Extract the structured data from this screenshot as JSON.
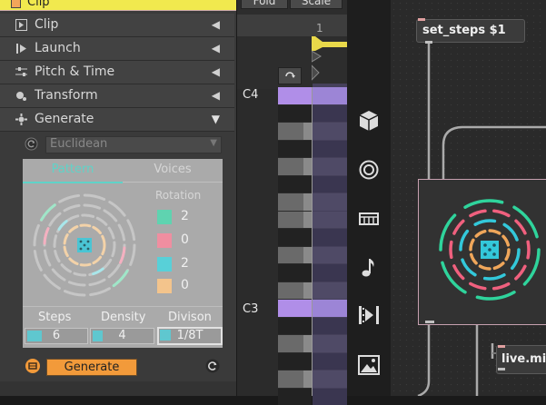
{
  "clip_header": {
    "label": "Clip"
  },
  "sections": [
    {
      "label": "Clip",
      "icon": "clip-icon",
      "arrow": "◀"
    },
    {
      "label": "Launch",
      "icon": "launch-icon",
      "arrow": "◀"
    },
    {
      "label": "Pitch & Time",
      "icon": "sliders-icon",
      "arrow": "◀"
    },
    {
      "label": "Transform",
      "icon": "transform-icon",
      "arrow": "◀"
    },
    {
      "label": "Generate",
      "icon": "generate-icon",
      "arrow": "▼"
    }
  ],
  "generator": {
    "algorithm": "Euclidean",
    "tabs": [
      "Pattern",
      "Voices"
    ],
    "rotation_label": "Rotation",
    "rotations": [
      {
        "value": "2",
        "color": "#5fd3b0"
      },
      {
        "value": "0",
        "color": "#f08ea0"
      },
      {
        "value": "2",
        "color": "#58d0d8"
      },
      {
        "value": "0",
        "color": "#f3c48c"
      }
    ],
    "params": [
      {
        "label": "Steps",
        "value": "6"
      },
      {
        "label": "Density",
        "value": "4"
      },
      {
        "label": "Divison",
        "value": "1/8T"
      }
    ],
    "generate_label": "Generate"
  },
  "piano_roll": {
    "top_buttons": [
      "Fold",
      "Scale"
    ],
    "bar_marker": "1",
    "note_labels": [
      "C4",
      "C3"
    ]
  },
  "icon_strip": [
    "cube-icon",
    "circle-target-icon",
    "bank-icon",
    "music-note-icon",
    "clip-play-icon",
    "image-icon"
  ],
  "patcher": {
    "message_box": "set_steps $1",
    "object_box": "live.mid"
  },
  "colors": {
    "accent_yellow": "#f1e94e",
    "note_purple": "#b08ee8",
    "generate_orange": "#f29a3a",
    "ring_green": "#2fd49c",
    "ring_cyan": "#33c8da",
    "ring_pink": "#f0607e",
    "ring_orange": "#f0a65a"
  }
}
